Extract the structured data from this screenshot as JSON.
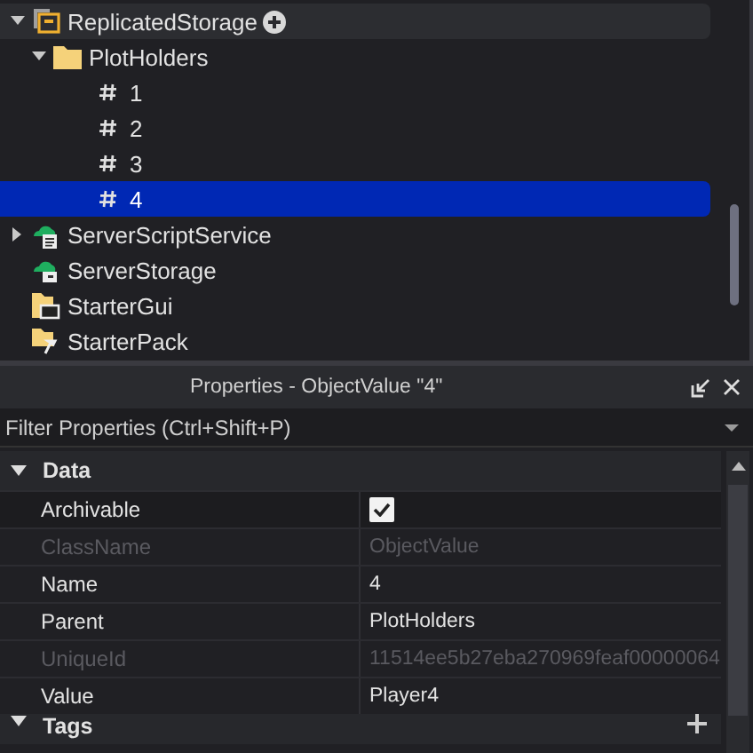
{
  "explorer": {
    "items": [
      {
        "name": "ReplicatedStorage",
        "kind": "storage",
        "expanded": true,
        "hovered": true,
        "selected": false,
        "children": [
          {
            "name": "PlotHolders",
            "kind": "folder",
            "expanded": true,
            "hovered": false,
            "selected": false,
            "children": [
              {
                "name": "1",
                "kind": "value",
                "hovered": false,
                "selected": false
              },
              {
                "name": "2",
                "kind": "value",
                "hovered": false,
                "selected": false
              },
              {
                "name": "3",
                "kind": "value",
                "hovered": false,
                "selected": false
              },
              {
                "name": "4",
                "kind": "value",
                "hovered": false,
                "selected": true
              }
            ]
          }
        ]
      },
      {
        "name": "ServerScriptService",
        "kind": "script-service",
        "expanded": false,
        "hovered": false,
        "selected": false
      },
      {
        "name": "ServerStorage",
        "kind": "server-storage",
        "hovered": false,
        "selected": false
      },
      {
        "name": "StarterGui",
        "kind": "gui-folder",
        "hovered": false,
        "selected": false
      },
      {
        "name": "StarterPack",
        "kind": "pack-folder",
        "hovered": false,
        "selected": false
      }
    ]
  },
  "properties": {
    "title": "Properties - ObjectValue \"4\"",
    "filter": {
      "placeholder": "Filter Properties (Ctrl+Shift+P)"
    },
    "sections": [
      {
        "name": "Data",
        "expanded": true,
        "rows": [
          {
            "name": "Archivable",
            "kind": "checkbox",
            "checked": true,
            "disabled": false
          },
          {
            "name": "ClassName",
            "kind": "text",
            "value": "ObjectValue",
            "disabled": true
          },
          {
            "name": "Name",
            "kind": "text",
            "value": "4",
            "disabled": false
          },
          {
            "name": "Parent",
            "kind": "text",
            "value": "PlotHolders",
            "disabled": false
          },
          {
            "name": "UniqueId",
            "kind": "text",
            "value": "11514ee5b27eba270969feaf00000064",
            "disabled": true
          },
          {
            "name": "Value",
            "kind": "text",
            "value": "Player4",
            "disabled": false
          }
        ]
      },
      {
        "name": "Tags",
        "expanded": true
      }
    ]
  }
}
